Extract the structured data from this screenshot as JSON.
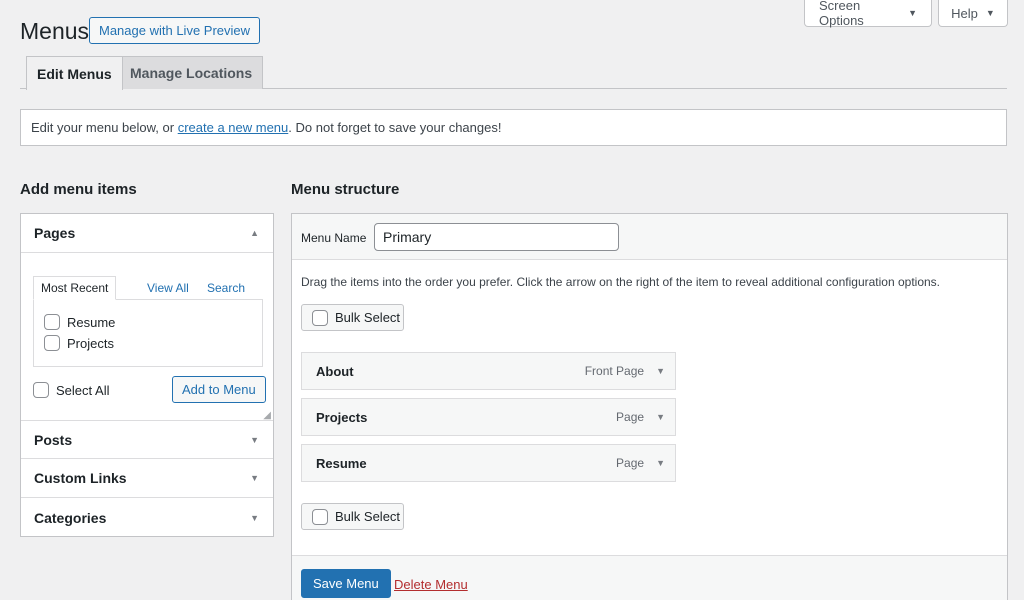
{
  "header": {
    "title": "Menus",
    "live_preview_label": "Manage with Live Preview",
    "screen_options_label": "Screen Options",
    "help_label": "Help"
  },
  "tabs": [
    {
      "label": "Edit Menus",
      "active": true
    },
    {
      "label": "Manage Locations",
      "active": false
    }
  ],
  "notice": {
    "before": "Edit your menu below, or ",
    "link": "create a new menu",
    "after": ". Do not forget to save your changes!"
  },
  "add_items": {
    "heading": "Add menu items",
    "sections": [
      {
        "label": "Pages",
        "expanded": true
      },
      {
        "label": "Posts",
        "expanded": false
      },
      {
        "label": "Custom Links",
        "expanded": false
      },
      {
        "label": "Categories",
        "expanded": false
      }
    ],
    "pages_tabs": [
      "Most Recent",
      "View All",
      "Search"
    ],
    "pages_list": [
      "Resume",
      "Projects"
    ],
    "select_all_label": "Select All",
    "add_button_label": "Add to Menu"
  },
  "menu_structure": {
    "heading": "Menu structure",
    "menu_name_label": "Menu Name",
    "menu_name_value": "Primary",
    "instructions": "Drag the items into the order you prefer. Click the arrow on the right of the item to reveal additional configuration options.",
    "bulk_select_label": "Bulk Select",
    "items": [
      {
        "title": "About",
        "type": "Front Page"
      },
      {
        "title": "Projects",
        "type": "Page"
      },
      {
        "title": "Resume",
        "type": "Page"
      }
    ],
    "save_label": "Save Menu",
    "delete_label": "Delete Menu"
  },
  "colors": {
    "accent": "#2271b1",
    "danger": "#b32d2e",
    "background": "#f0f0f1"
  }
}
